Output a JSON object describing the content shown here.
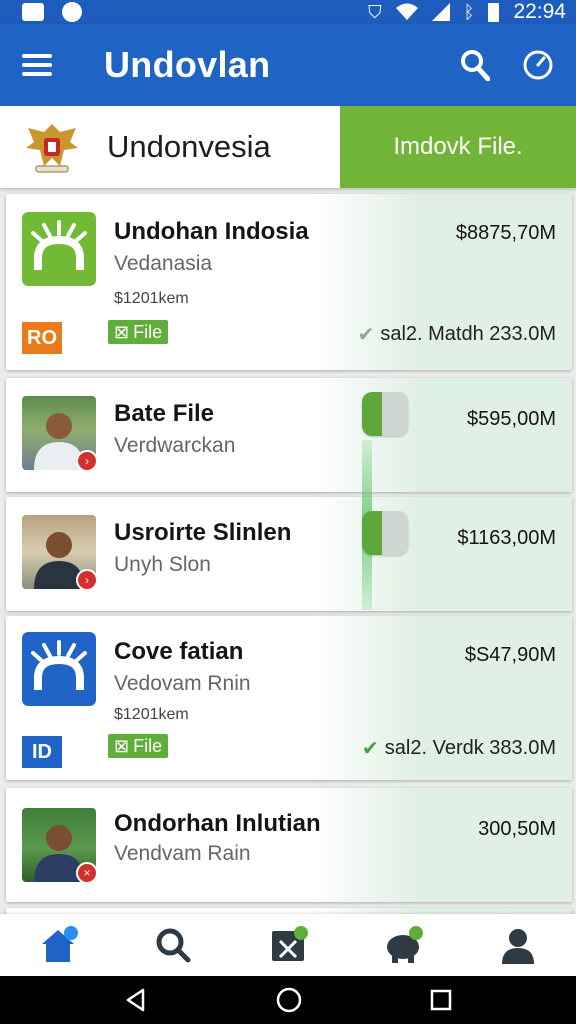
{
  "status_bar": {
    "time": "22:94",
    "icons": [
      "message-icon",
      "app-icon",
      "shield-icon",
      "wifi-icon",
      "signal-icon",
      "bluetooth-icon",
      "battery-icon"
    ]
  },
  "app_bar": {
    "title": "Undovlan",
    "menu_icon": "hamburger-icon",
    "actions": [
      "search-icon",
      "compass-icon"
    ]
  },
  "banner": {
    "title": "Undonvesia",
    "action_label": "Imdovk File.",
    "emblem_icon": "garuda-emblem-icon"
  },
  "cards": [
    {
      "title": "Undohan Indosia",
      "subtitle": "Vedanasia",
      "meta": "$1201kem",
      "price": "$8875,70M",
      "tag": "File",
      "status": "sal2. Matdh 233.0M",
      "mini_logo": "RO",
      "thumb": "green-app-tile"
    },
    {
      "title": "Bate File",
      "subtitle": "Verdwarckan",
      "price": "$595,00M",
      "thumb": "person-photo"
    },
    {
      "title": "Usroirte Slinlen",
      "subtitle": "Unyh Slon",
      "price": "$1163,00M",
      "thumb": "person-photo"
    },
    {
      "title": "Cove fatian",
      "subtitle": "Vedovam Rnin",
      "meta": "$1201kem",
      "price": "$S47,90M",
      "tag": "File",
      "status": "sal2. Verdk 383.0M",
      "mini_logo": "ID",
      "thumb": "blue-app-tile"
    },
    {
      "title": "Ondorhan Inlutian",
      "subtitle": "Vendvam Rain",
      "price": "300,50M",
      "thumb": "person-photo"
    }
  ],
  "bottom_nav": [
    "home-icon",
    "search-icon",
    "file-icon",
    "savings-icon",
    "profile-icon"
  ],
  "colors": {
    "primary": "#1f63c4",
    "accent_green": "#71b437",
    "tag_green": "#5fae3a",
    "badge_red": "#d32f2f"
  }
}
